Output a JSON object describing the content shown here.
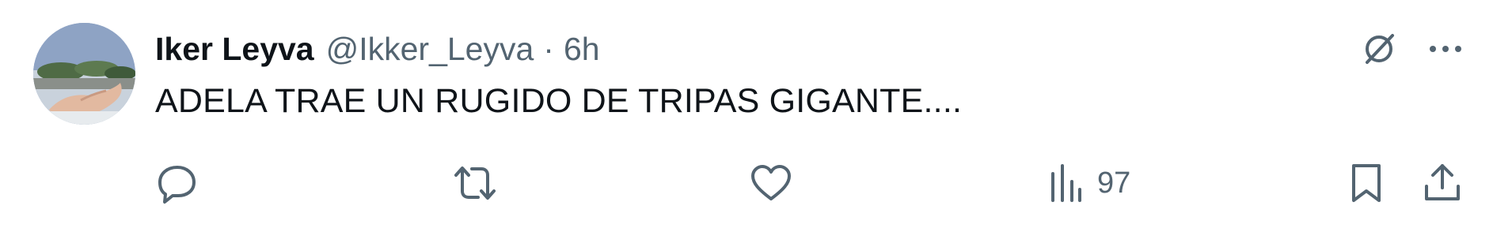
{
  "tweet": {
    "author": {
      "display_name": "Iker Leyva",
      "handle": "@Ikker_Leyva"
    },
    "separator": "·",
    "time": "6h",
    "text": "ADELA TRAE UN RUGIDO DE TRIPAS GIGANTE....",
    "actions": {
      "reply_icon": "reply-icon",
      "retweet_icon": "retweet-icon",
      "like_icon": "heart-icon",
      "views_icon": "views-chart-icon",
      "views_count": "97",
      "bookmark_icon": "bookmark-icon",
      "share_icon": "share-icon"
    },
    "top_icons": {
      "grok": "grok-icon",
      "more": "more-icon"
    }
  },
  "colors": {
    "text_primary": "#0f1419",
    "text_secondary": "#536471",
    "background": "#ffffff"
  }
}
